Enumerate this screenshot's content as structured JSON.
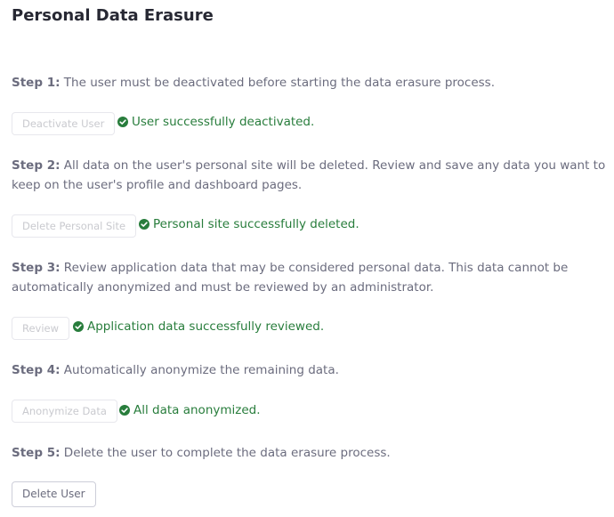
{
  "title": "Personal Data Erasure",
  "steps": [
    {
      "label": "Step 1:",
      "text": "The user must be deactivated before starting the data erasure process.",
      "button": "Deactivate User",
      "status": "User successfully deactivated."
    },
    {
      "label": "Step 2:",
      "text": "All data on the user's personal site will be deleted. Review and save any data you want to keep on the user's profile and dashboard pages.",
      "button": "Delete Personal Site",
      "status": "Personal site successfully deleted."
    },
    {
      "label": "Step 3:",
      "text": "Review application data that may be considered personal data. This data cannot be automatically anonymized and must be reviewed by an administrator.",
      "button": "Review",
      "status": "Application data successfully reviewed."
    },
    {
      "label": "Step 4:",
      "text": "Automatically anonymize the remaining data.",
      "button": "Anonymize Data",
      "status": "All data anonymized."
    },
    {
      "label": "Step 5:",
      "text": "Delete the user to complete the data erasure process.",
      "button": "Delete User"
    }
  ],
  "colors": {
    "success": "#287d3c",
    "text": "#6b6c7e",
    "heading": "#272833",
    "disabled_text": "#c9cacf"
  },
  "icons": {
    "status": "check-circle-icon"
  }
}
